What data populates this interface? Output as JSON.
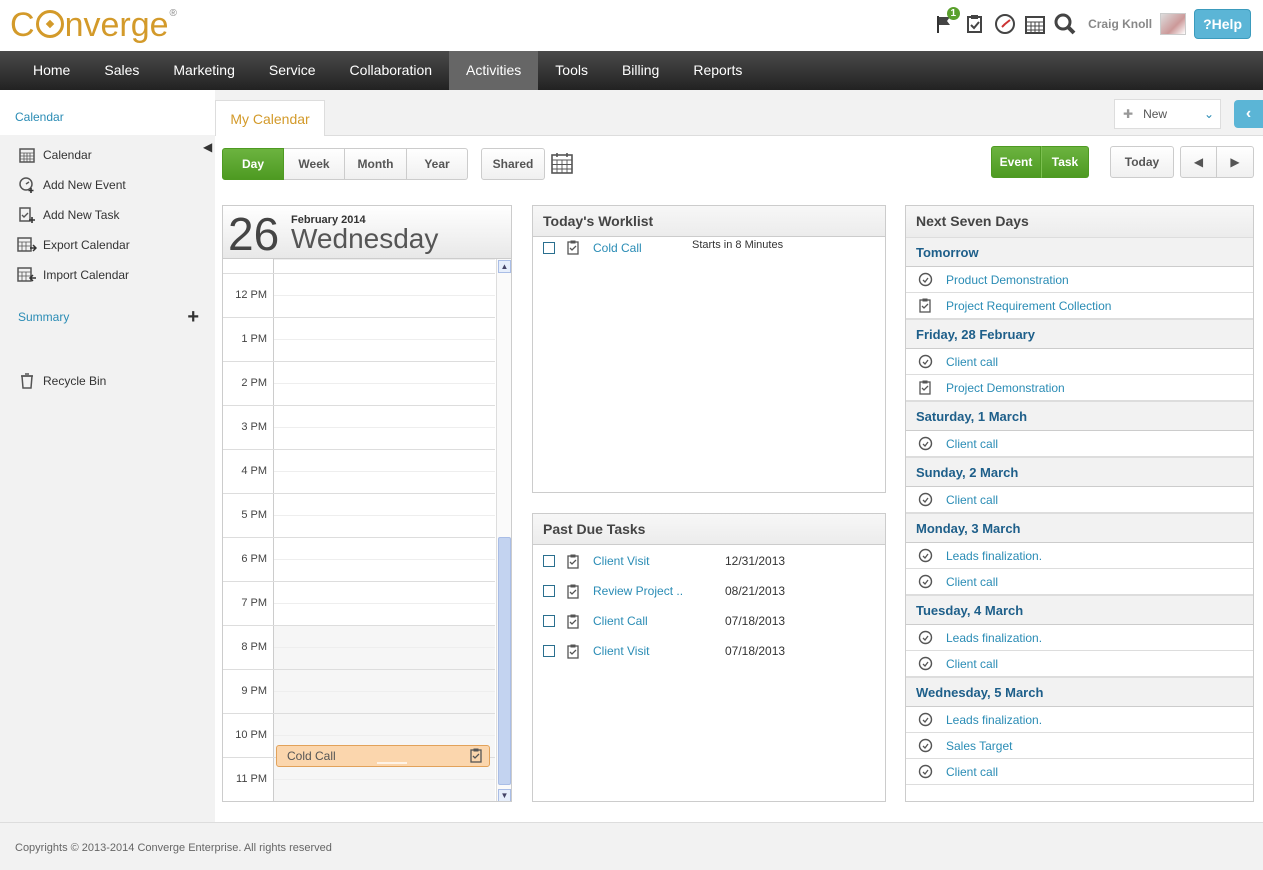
{
  "header": {
    "brand_pre": "C",
    "brand_post": "nverge",
    "brand_reg": "®",
    "flag_badge": "1",
    "user_name": "Craig Knoll",
    "help_label": "?Help",
    "icons": [
      "flag-icon",
      "task-icon",
      "event-icon",
      "calendar-icon",
      "search-icon"
    ]
  },
  "nav": {
    "items": [
      "Home",
      "Sales",
      "Marketing",
      "Service",
      "Collaboration",
      "Activities",
      "Tools",
      "Billing",
      "Reports"
    ],
    "active": "Activities"
  },
  "sidebar": {
    "title": "Calendar",
    "items": [
      {
        "label": "Calendar",
        "icon": "calendar-icon"
      },
      {
        "label": "Add New Event",
        "icon": "add-event-icon"
      },
      {
        "label": "Add New Task",
        "icon": "add-task-icon"
      },
      {
        "label": "Export Calendar",
        "icon": "export-calendar-icon"
      },
      {
        "label": "Import Calendar",
        "icon": "import-calendar-icon"
      }
    ],
    "summary_label": "Summary",
    "recycle_label": "Recycle Bin"
  },
  "main": {
    "tab": "My Calendar",
    "new_label": "New",
    "view_buttons": [
      "Day",
      "Week",
      "Month",
      "Year"
    ],
    "active_view": "Day",
    "shared_label": "Shared",
    "event_label": "Event",
    "task_label": "Task",
    "today_label": "Today"
  },
  "day": {
    "number": "26",
    "month_year": "February 2014",
    "weekday": "Wednesday",
    "hours": [
      "12 PM",
      "1 PM",
      "2 PM",
      "3 PM",
      "4 PM",
      "5 PM",
      "6 PM",
      "7 PM",
      "8 PM",
      "9 PM",
      "10 PM",
      "11 PM"
    ],
    "event": {
      "title": "Cold Call"
    }
  },
  "worklist": {
    "title": "Today's Worklist",
    "items": [
      {
        "label": "Cold Call",
        "note": "Starts in 8 Minutes"
      }
    ]
  },
  "past_due": {
    "title": "Past Due Tasks",
    "items": [
      {
        "label": "Client Visit",
        "date": "12/31/2013"
      },
      {
        "label": "Review Project ..",
        "date": "08/21/2013"
      },
      {
        "label": "Client Call",
        "date": "07/18/2013"
      },
      {
        "label": "Client Visit",
        "date": "07/18/2013"
      }
    ]
  },
  "next_seven": {
    "title": "Next Seven Days",
    "groups": [
      {
        "day": "Tomorrow",
        "items": [
          {
            "label": "Product Demonstration",
            "kind": "event"
          },
          {
            "label": "Project Requirement Collection",
            "kind": "task"
          }
        ]
      },
      {
        "day": "Friday, 28 February",
        "items": [
          {
            "label": "Client call",
            "kind": "event"
          },
          {
            "label": "Project Demonstration",
            "kind": "task"
          }
        ]
      },
      {
        "day": "Saturday, 1 March",
        "items": [
          {
            "label": "Client call",
            "kind": "event"
          }
        ]
      },
      {
        "day": "Sunday, 2 March",
        "items": [
          {
            "label": "Client call",
            "kind": "event"
          }
        ]
      },
      {
        "day": "Monday, 3 March",
        "items": [
          {
            "label": "Leads finalization.",
            "kind": "event"
          },
          {
            "label": "Client call",
            "kind": "event"
          }
        ]
      },
      {
        "day": "Tuesday, 4 March",
        "items": [
          {
            "label": "Leads finalization.",
            "kind": "event"
          },
          {
            "label": "Client call",
            "kind": "event"
          }
        ]
      },
      {
        "day": "Wednesday, 5 March",
        "items": [
          {
            "label": "Leads finalization.",
            "kind": "event"
          },
          {
            "label": "Sales Target",
            "kind": "event"
          },
          {
            "label": "Client call",
            "kind": "event"
          }
        ]
      }
    ]
  },
  "footer": {
    "text": "Copyrights © 2013-2014 Converge Enterprise. All rights reserved"
  },
  "colors": {
    "brand": "#d39a2a",
    "link": "#2a8cb5",
    "green": "#5aa02c",
    "nav_dark": "#222222",
    "event_fill": "#fbd6ad"
  }
}
